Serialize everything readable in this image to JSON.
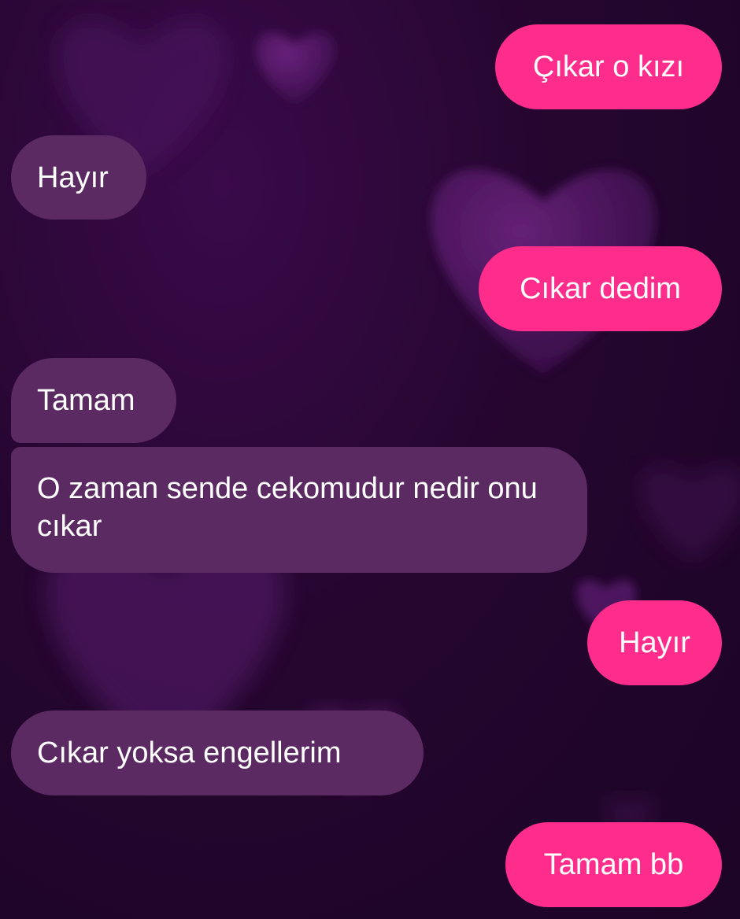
{
  "chat": {
    "messages": [
      {
        "side": "outgoing",
        "text": "Çıkar o kızı"
      },
      {
        "side": "incoming",
        "text": "Hayır"
      },
      {
        "side": "outgoing",
        "text": "Cıkar dedim"
      },
      {
        "side": "incoming",
        "text": "Tamam"
      },
      {
        "side": "incoming",
        "text": "O zaman sende cekomudur nedir onu cıkar"
      },
      {
        "side": "outgoing",
        "text": "Hayır"
      },
      {
        "side": "incoming",
        "text": "Cıkar yoksa engellerim"
      },
      {
        "side": "outgoing",
        "text": "Tamam bb"
      }
    ]
  },
  "colors": {
    "outgoing_bubble": "#fe2d8c",
    "incoming_bubble": "#5c2a62",
    "background": "#25062f",
    "text": "#ffffff"
  },
  "background_theme": "purple-hearts"
}
